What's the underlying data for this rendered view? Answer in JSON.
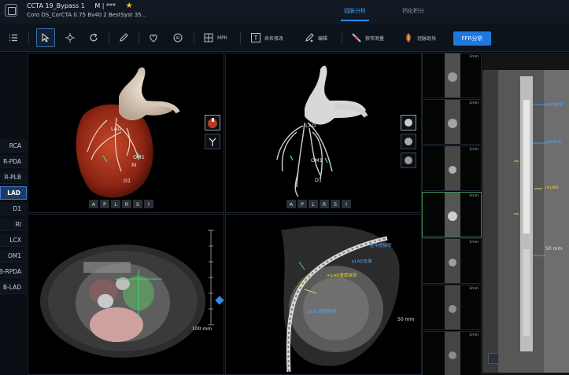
{
  "titlebar": {
    "patient_name": "CCTA 19_Bypass 1",
    "patient_meta": "M | ***",
    "series": "Coro DS_CorCTA 0.75 Bv40 2 BestSyst 35...",
    "tabs": [
      "冠脉分析",
      "钙化积分"
    ],
    "active_tab": 0
  },
  "toolbar": {
    "mpr_label": "MPR",
    "rename_label": "命名修改",
    "edit_label": "编辑",
    "stenosis_label": "狭窄测量",
    "plaque_label": "冠脉斑块",
    "ffr_label": "FFR分析"
  },
  "vessels": {
    "items": [
      "RCA",
      "R-PDA",
      "R-PLB",
      "LAD",
      "D1",
      "RI",
      "LCX",
      "OM1",
      "B-RPDA",
      "B-LAD"
    ],
    "active": "LAD"
  },
  "vr_view": {
    "labels": [
      "LAD",
      "OM1",
      "RI",
      "D1"
    ],
    "orientation": [
      "A",
      "P",
      "L",
      "R",
      "S",
      "I"
    ]
  },
  "tree_view": {
    "labels": [
      "LAD",
      "OM1",
      "D1"
    ],
    "orientation": [
      "A",
      "P",
      "L",
      "R",
      "S",
      "I"
    ]
  },
  "axial_view": {
    "scale": "100 mm"
  },
  "curved_view": {
    "scale": "50 mm",
    "labels": {
      "l1": "近中度狭窄",
      "l2": "pLAD支架",
      "l3": "mLAD重度狭窄",
      "l4": "pLAD重度狭窄"
    }
  },
  "strip": {
    "mm_labels": [
      "2mm",
      "2mm",
      "1mm",
      "0mm",
      "1mm",
      "2mm",
      "2mm"
    ],
    "selected": 3
  },
  "longview": {
    "labels": [
      "LMF狭窄",
      "pLAD-S",
      "mLAD",
      "50 mm"
    ]
  },
  "colors": {
    "accent": "#2c8cf4",
    "active_vessel": "#1d3b64",
    "stent_label": "#4da6ff",
    "lesion_label": "#e8d534"
  }
}
